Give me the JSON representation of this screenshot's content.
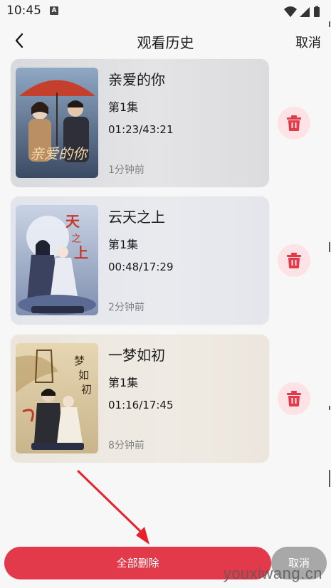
{
  "status_bar": {
    "time": "10:45",
    "notification_letter": "A"
  },
  "header": {
    "title": "观看历史",
    "cancel_label": "取消",
    "back_icon": "chevron-left-icon"
  },
  "history": [
    {
      "title": "亲爱的你",
      "episode": "第1集",
      "progress": "01:23/43:21",
      "time_ago": "1分钟前"
    },
    {
      "title": "云天之上",
      "episode": "第1集",
      "progress": "00:48/17:29",
      "time_ago": "2分钟前"
    },
    {
      "title": "一梦如初",
      "episode": "第1集",
      "progress": "01:16/17:45",
      "time_ago": "8分钟前"
    }
  ],
  "footer": {
    "delete_all_label": "全部删除",
    "cancel_label": "取消"
  },
  "watermark": "youxiwang.cn",
  "colors": {
    "accent": "#e23a4a",
    "delete_bg": "#fde3e6",
    "cancel_gray": "#a8a8a8"
  }
}
